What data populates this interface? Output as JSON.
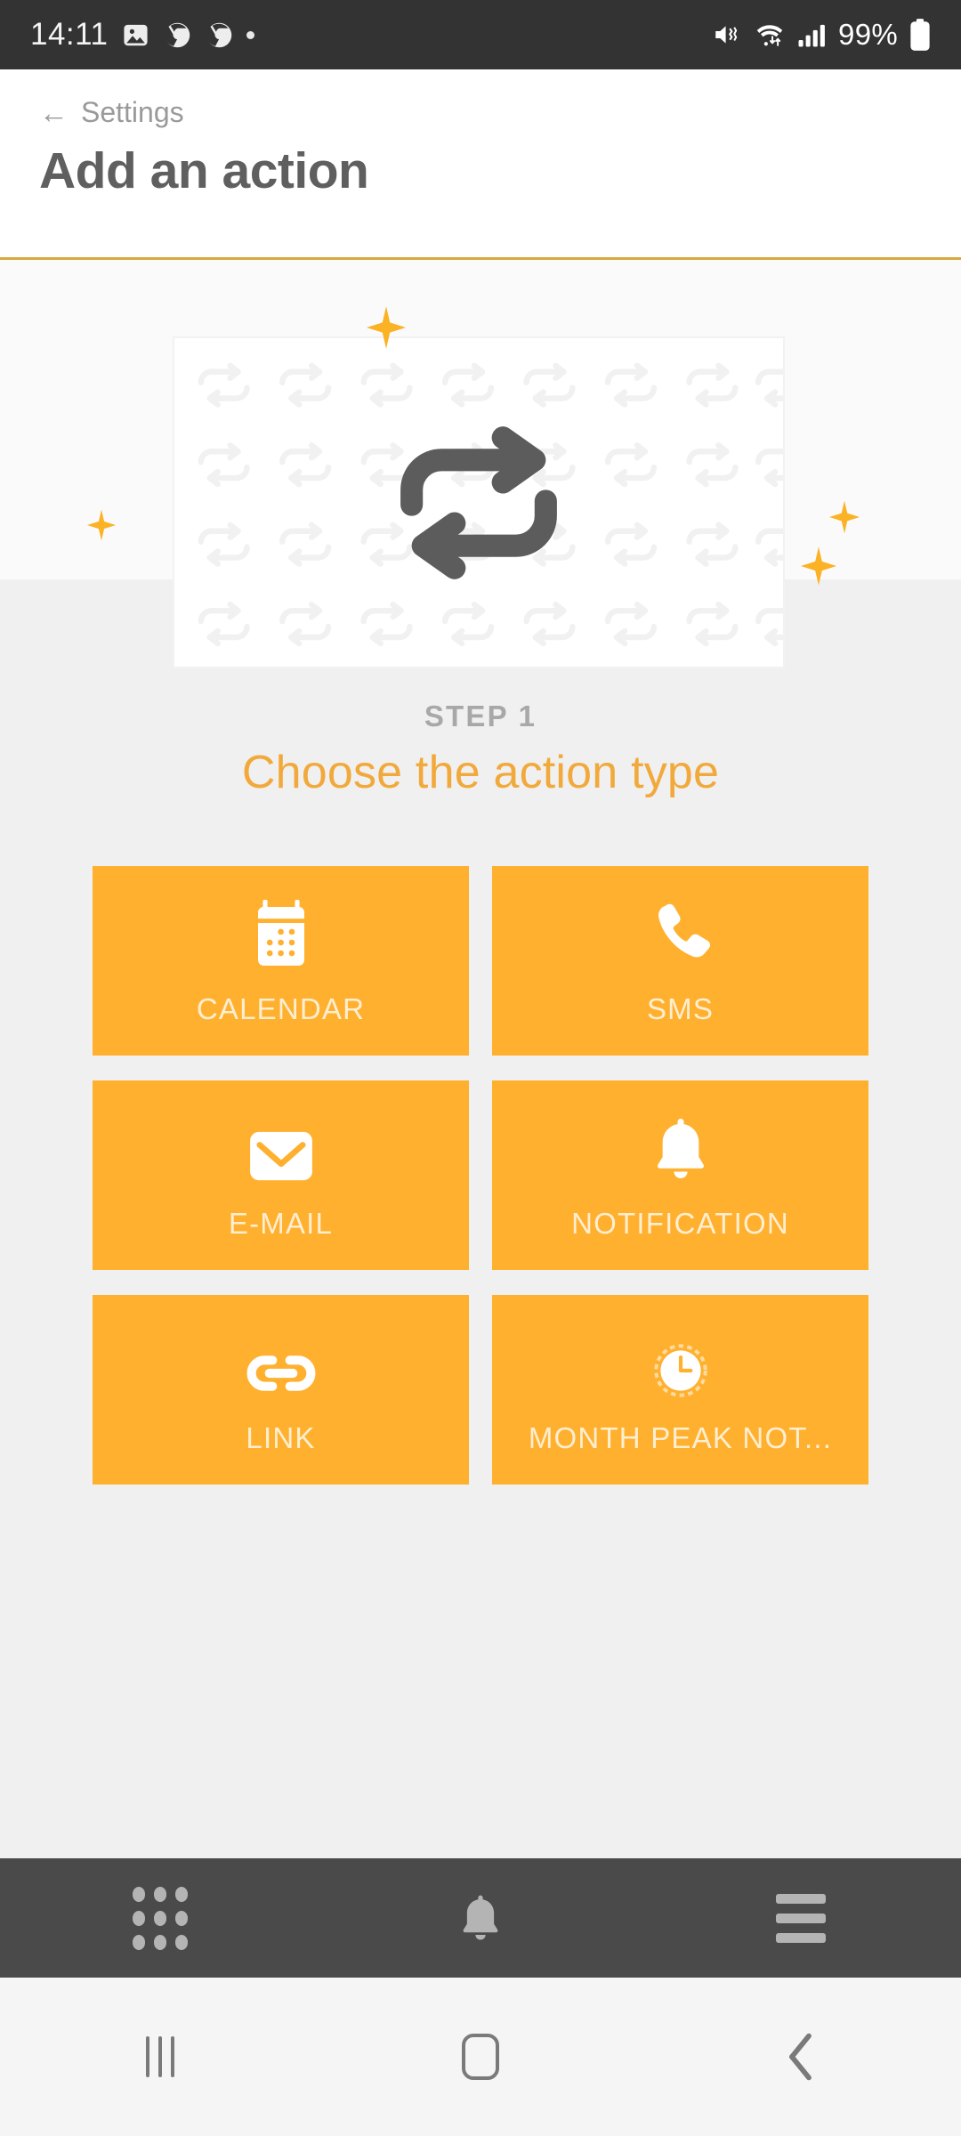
{
  "statusbar": {
    "time": "14:11",
    "battery_percent": "99%",
    "left_icons": [
      "image-icon",
      "chrome-icon",
      "chrome-icon",
      "dot-indicator"
    ],
    "right_icons": [
      "mute-vibrate-icon",
      "wifi-icon",
      "signal-bars-icon",
      "battery-icon"
    ]
  },
  "header": {
    "breadcrumb_label": "Settings",
    "back_icon": "arrow-left-icon",
    "title": "Add an action",
    "accent_color": "#D9A93F"
  },
  "hero": {
    "illustration_icon": "repeat-loop-icon",
    "sparkle_icon": "sparkle-icon",
    "pattern_icon": "repeat-loop-icon"
  },
  "step": {
    "label": "STEP 1",
    "title": "Choose the action type",
    "title_color": "#F2A93B"
  },
  "actions": {
    "tile_color": "#FFB02E",
    "items": [
      {
        "label": "CALENDAR",
        "icon": "calendar-icon"
      },
      {
        "label": "SMS",
        "icon": "phone-handset-icon"
      },
      {
        "label": "E-MAIL",
        "icon": "envelope-icon"
      },
      {
        "label": "NOTIFICATION",
        "icon": "bell-icon"
      },
      {
        "label": "LINK",
        "icon": "chain-link-icon"
      },
      {
        "label": "MONTH PEAK NOT...",
        "icon": "clock-icon"
      }
    ]
  },
  "appbar": {
    "items": [
      {
        "name": "apps-grid",
        "icon": "grid-dots-icon"
      },
      {
        "name": "notifications",
        "icon": "bell-icon"
      },
      {
        "name": "menu",
        "icon": "hamburger-icon"
      }
    ]
  },
  "navbar": {
    "items": [
      {
        "name": "recents",
        "icon": "recents-icon"
      },
      {
        "name": "home",
        "icon": "home-square-icon"
      },
      {
        "name": "back",
        "icon": "chevron-left-icon"
      }
    ]
  }
}
